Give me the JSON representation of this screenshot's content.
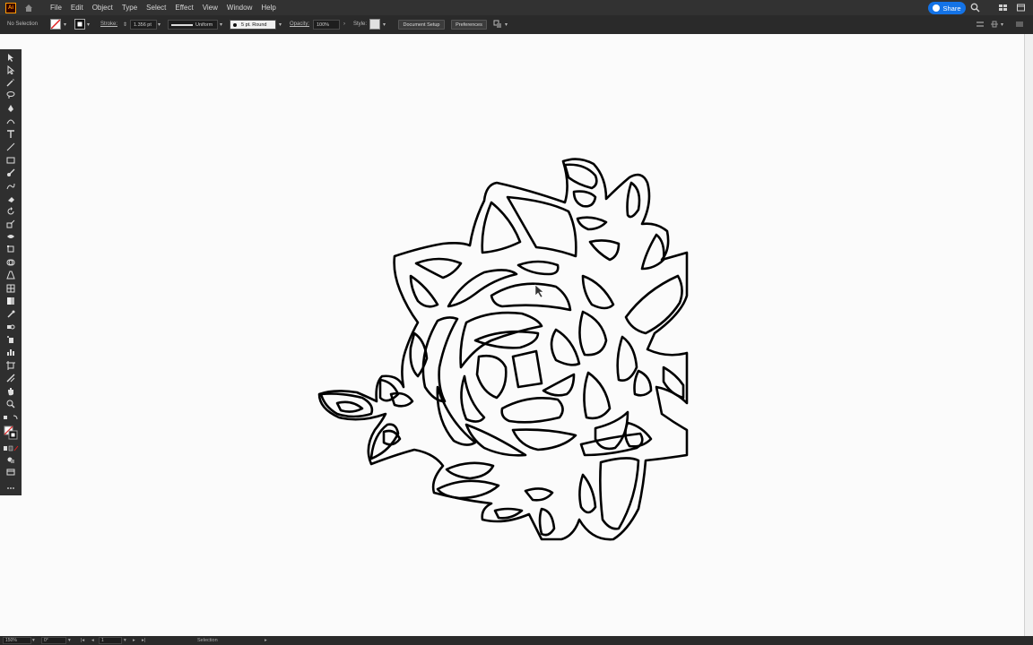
{
  "menubar": {
    "app_logo": "Ai",
    "items": [
      "File",
      "Edit",
      "Object",
      "Type",
      "Select",
      "Effect",
      "View",
      "Window",
      "Help"
    ],
    "share_label": "Share"
  },
  "controlbar": {
    "selection": "No Selection",
    "stroke_label": "Stroke:",
    "stroke_weight": "1.356 pt",
    "uniform": "Uniform",
    "brush": "5 pt. Round",
    "opacity_label": "Opacity:",
    "opacity_value": "100%",
    "style_label": "Style:",
    "document_setup": "Document Setup",
    "preferences": "Preferences"
  },
  "statusbar": {
    "zoom": "150%",
    "rotation": "0°",
    "artboard": "1",
    "tool": "Selection"
  },
  "toolbar": {
    "tools": [
      "selection-tool",
      "direct-selection-tool",
      "magic-wand-tool",
      "lasso-tool",
      "pen-tool",
      "curvature-tool",
      "type-tool",
      "line-tool",
      "rectangle-tool",
      "paintbrush-tool",
      "shaper-tool",
      "eraser-tool",
      "rotate-tool",
      "scale-tool",
      "width-tool",
      "free-transform-tool",
      "shape-builder-tool",
      "perspective-grid-tool",
      "mesh-tool",
      "gradient-tool",
      "eyedropper-tool",
      "blend-tool",
      "symbol-sprayer-tool",
      "column-graph-tool",
      "artboard-tool",
      "slice-tool",
      "hand-tool",
      "zoom-tool"
    ]
  },
  "colors": {
    "menubar_bg": "#323232",
    "controlbar_bg": "#2a2a2a",
    "toolbar_bg": "#2f2f2f",
    "canvas_bg": "#fbfbfb",
    "share_blue": "#1473e6",
    "artwork_stroke": "#000000"
  }
}
